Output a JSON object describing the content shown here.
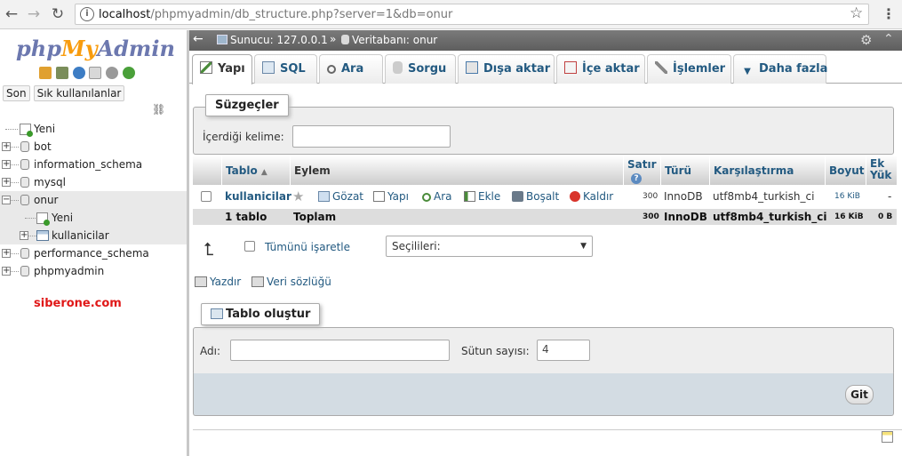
{
  "browser": {
    "url_host": "localhost",
    "url_path": "/phpmyadmin/db_structure.php?server=1&db=onur"
  },
  "nav": {
    "logo_part1": "php",
    "logo_part2": "My",
    "logo_part3": "Admin",
    "tab_recent": "Son",
    "tab_favorites": "Sık kullanılanlar",
    "tree": [
      {
        "label": "Yeni",
        "type": "new"
      },
      {
        "label": "bot",
        "type": "db"
      },
      {
        "label": "information_schema",
        "type": "db"
      },
      {
        "label": "mysql",
        "type": "db"
      },
      {
        "label": "onur",
        "type": "db"
      },
      {
        "label": "Yeni",
        "type": "new-child"
      },
      {
        "label": "kullanicilar",
        "type": "table-child"
      },
      {
        "label": "performance_schema",
        "type": "db"
      },
      {
        "label": "phpmyadmin",
        "type": "db"
      }
    ],
    "watermark": "siberone.com"
  },
  "breadcrumb": {
    "server": "Sunucu: 127.0.0.1",
    "sep": "»",
    "database": "Veritabanı: onur"
  },
  "tabs": [
    {
      "label": "Yapı"
    },
    {
      "label": "SQL"
    },
    {
      "label": "Ara"
    },
    {
      "label": "Sorgu"
    },
    {
      "label": "Dışa aktar"
    },
    {
      "label": "İçe aktar"
    },
    {
      "label": "İşlemler"
    },
    {
      "label": "Daha fazla"
    }
  ],
  "filters": {
    "legend": "Süzgeçler",
    "label": "İçerdiği kelime:",
    "value": ""
  },
  "table": {
    "headers": {
      "table": "Tablo",
      "action": "Eylem",
      "rows_line1": "Satır",
      "type": "Türü",
      "collation": "Karşılaştırma",
      "size": "Boyut",
      "overhead_line1": "Ek",
      "overhead_line2": "Yük"
    },
    "row": {
      "name": "kullanicilar",
      "actions": [
        "Gözat",
        "Yapı",
        "Ara",
        "Ekle",
        "Boşalt",
        "Kaldır"
      ],
      "rows": "300",
      "type": "InnoDB",
      "collation": "utf8mb4_turkish_ci",
      "size": "16 KiB",
      "overhead": "-"
    },
    "total": {
      "name": "1 tablo",
      "label": "Toplam",
      "rows": "300",
      "type": "InnoDB",
      "collation": "utf8mb4_turkish_ci",
      "size": "16 KiB",
      "overhead": "0 B"
    }
  },
  "bulk": {
    "check_all": "Tümünü işaretle",
    "select": "Seçilileri:"
  },
  "links": {
    "print": "Yazdır",
    "dictionary": "Veri sözlüğü"
  },
  "create": {
    "legend": "Tablo oluştur",
    "name_label": "Adı:",
    "name_value": "",
    "cols_label": "Sütun sayısı:",
    "cols_value": "4",
    "go": "Git"
  },
  "colors": {
    "link": "#235a81",
    "logo_blue": "#6c78af",
    "logo_orange": "#f89c0e",
    "watermark": "#e01818"
  }
}
